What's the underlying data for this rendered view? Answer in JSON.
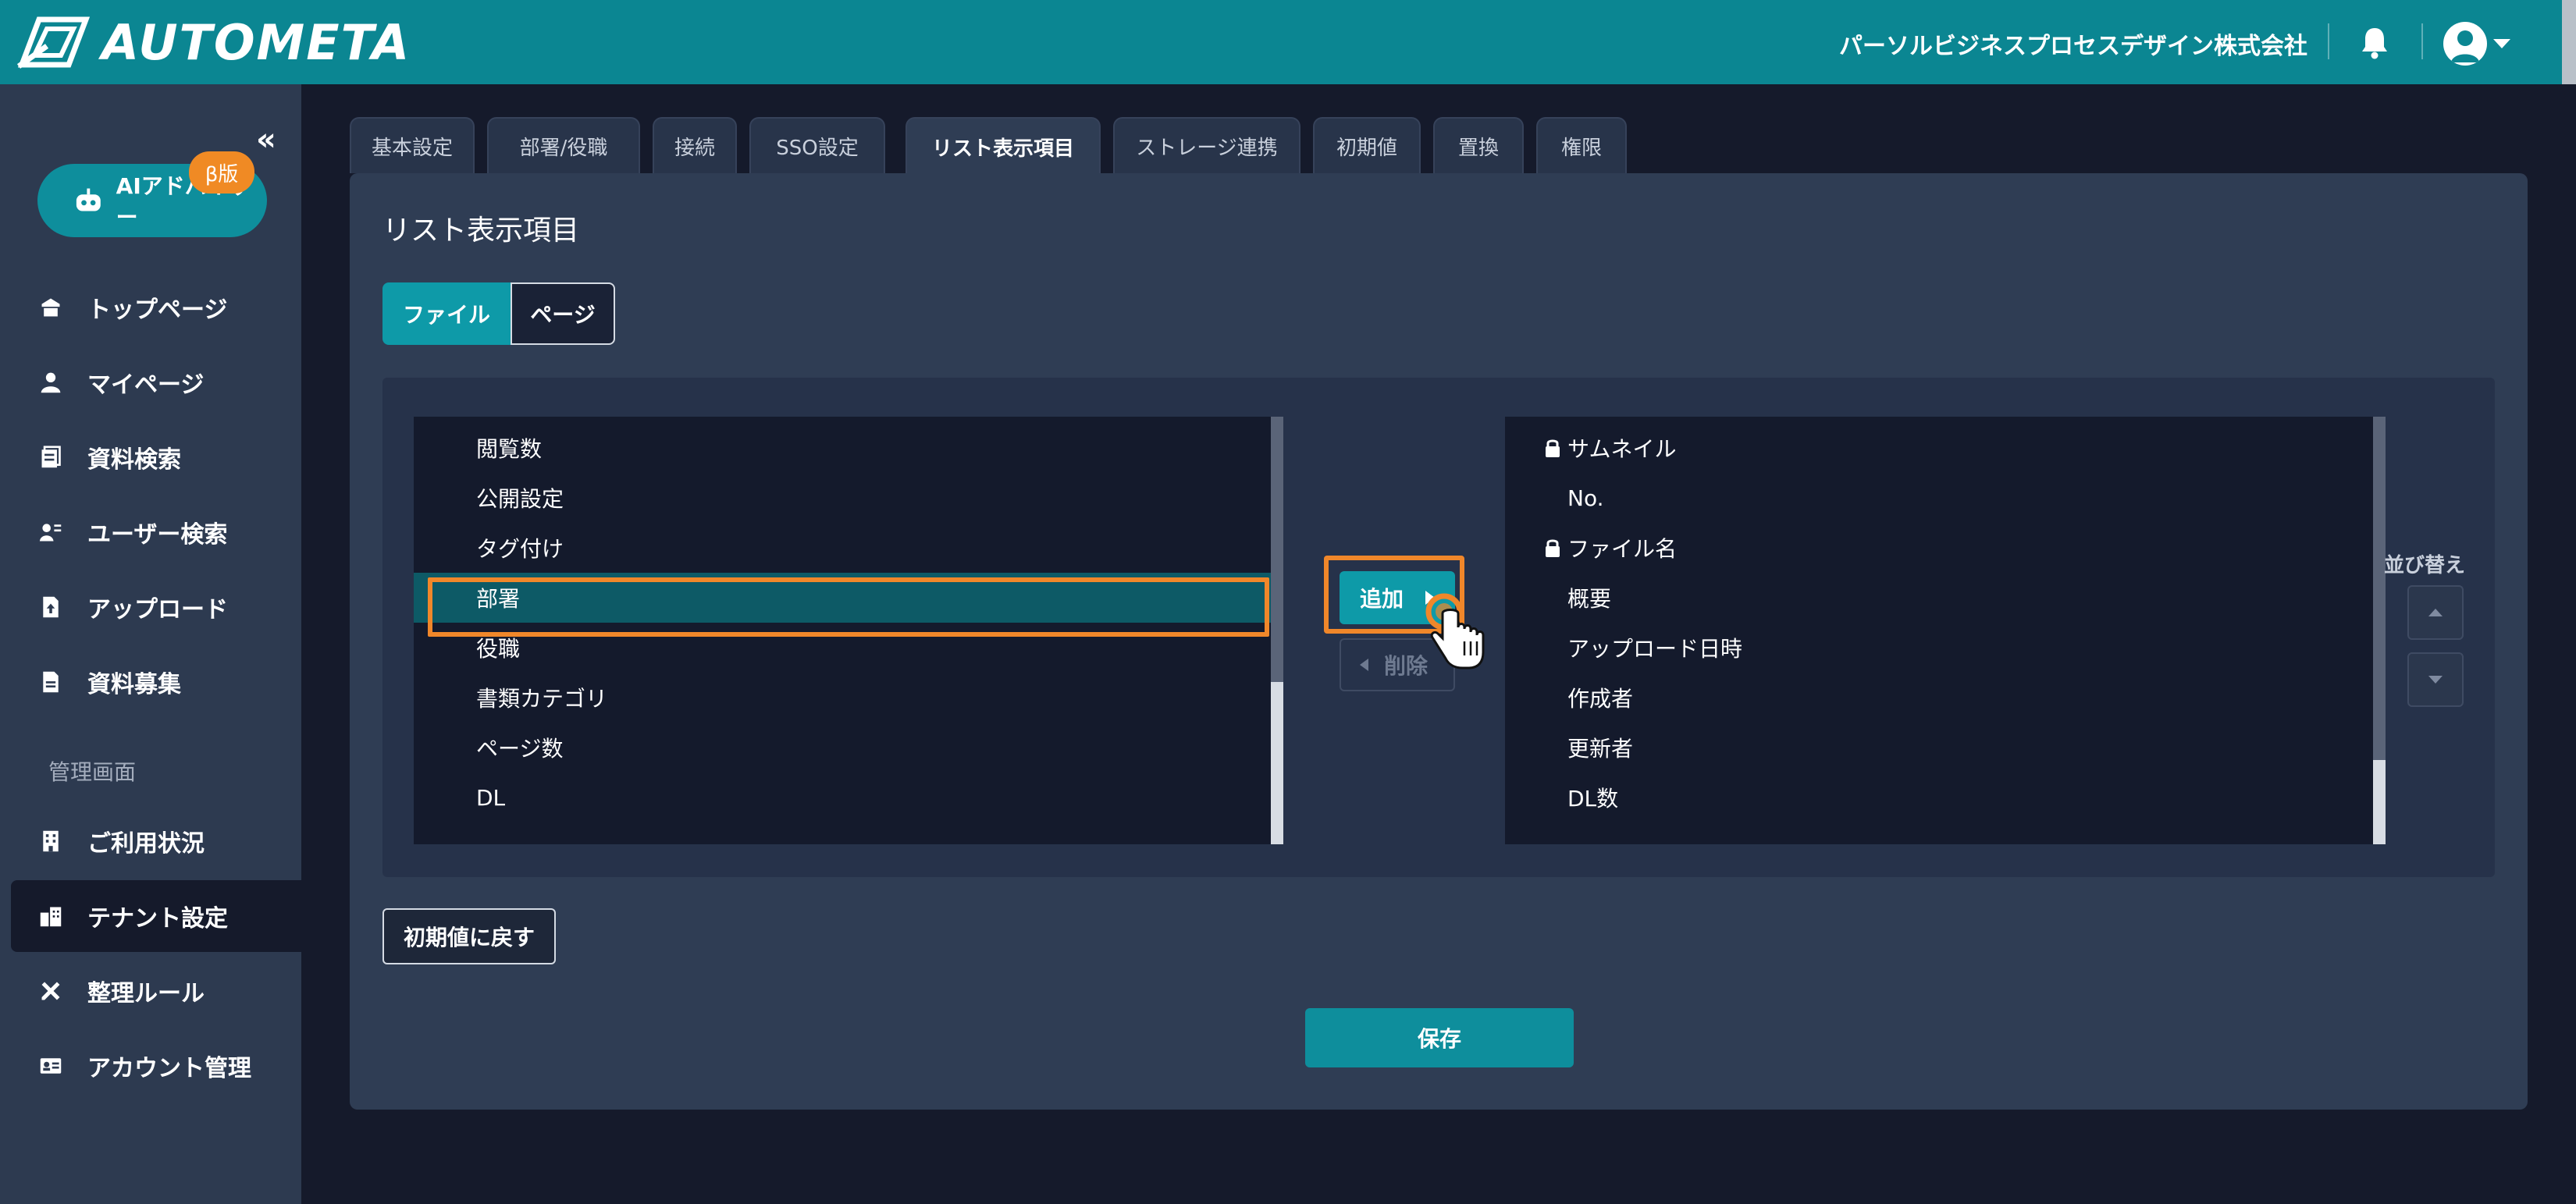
{
  "header": {
    "logo_text": "AUTOMETA",
    "company": "パーソルビジネスプロセスデザイン株式会社",
    "bell_icon": "bell-icon",
    "user_icon": "user-avatar-icon"
  },
  "sidebar": {
    "ai_advisor_label": "AIアドバイザー",
    "beta_badge": "β版",
    "items": [
      {
        "label": "トップページ",
        "icon": "home-icon"
      },
      {
        "label": "マイページ",
        "icon": "person-icon"
      },
      {
        "label": "資料検索",
        "icon": "document-search-icon"
      },
      {
        "label": "ユーザー検索",
        "icon": "user-search-icon"
      },
      {
        "label": "アップロード",
        "icon": "upload-icon"
      },
      {
        "label": "資料募集",
        "icon": "file-icon"
      }
    ],
    "section_label": "管理画面",
    "admin_items": [
      {
        "label": "ご利用状況",
        "icon": "building-icon"
      },
      {
        "label": "テナント設定",
        "icon": "tenant-icon"
      },
      {
        "label": "整理ルール",
        "icon": "tools-icon"
      },
      {
        "label": "アカウント管理",
        "icon": "id-card-icon"
      }
    ]
  },
  "tabs": [
    "基本設定",
    "部署/役職",
    "接続",
    "SSO設定",
    "リスト表示項目",
    "ストレージ連携",
    "初期値",
    "置換",
    "権限"
  ],
  "active_tab": "リスト表示項目",
  "panel": {
    "title": "リスト表示項目",
    "segment": {
      "file": "ファイル",
      "page": "ページ"
    },
    "left_items": [
      "閲覧数",
      "公開設定",
      "タグ付け",
      "部署",
      "役職",
      "書類カテゴリ",
      "ページ数",
      "DL"
    ],
    "selected_left": "部署",
    "right_items": [
      {
        "label": "サムネイル",
        "locked": true
      },
      {
        "label": "No.",
        "locked": false
      },
      {
        "label": "ファイル名",
        "locked": true
      },
      {
        "label": "概要",
        "locked": false
      },
      {
        "label": "アップロード日時",
        "locked": false
      },
      {
        "label": "作成者",
        "locked": false
      },
      {
        "label": "更新者",
        "locked": false
      },
      {
        "label": "DL数",
        "locked": false
      }
    ],
    "add_label": "追加",
    "delete_label": "削除",
    "sort_label": "並び替え",
    "reset_label": "初期値に戻す",
    "save_label": "保存"
  },
  "colors": {
    "header": "#0b8692",
    "accent": "#0e9aa8",
    "highlight": "#f0872a",
    "sidebar": "#2d3a50",
    "background": "#151a2b"
  }
}
